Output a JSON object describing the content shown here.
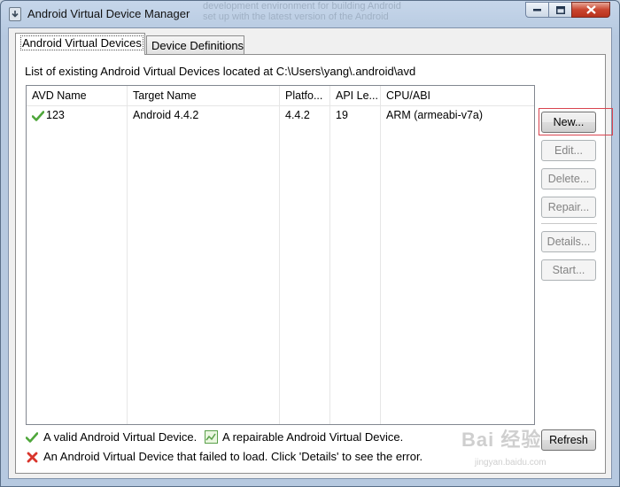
{
  "window": {
    "title": "Android Virtual Device Manager",
    "behind_text": [
      "development environment for building Android",
      "set up with the latest version of the Android"
    ]
  },
  "tabs": [
    {
      "label": "Android Virtual Devices",
      "active": true
    },
    {
      "label": "Device Definitions",
      "active": false
    }
  ],
  "list_label": "List of existing Android Virtual Devices located at C:\\Users\\yang\\.android\\avd",
  "table": {
    "columns": [
      "AVD Name",
      "Target Name",
      "Platfo...",
      "API Le...",
      "CPU/ABI"
    ],
    "rows": [
      {
        "status": "valid",
        "name": "123",
        "target": "Android 4.4.2",
        "platform": "4.4.2",
        "api": "19",
        "cpu": "ARM (armeabi-v7a)"
      }
    ]
  },
  "buttons": {
    "new": "New...",
    "edit": "Edit...",
    "delete": "Delete...",
    "repair": "Repair...",
    "details": "Details...",
    "start": "Start...",
    "refresh": "Refresh"
  },
  "legend": {
    "valid": "A valid Android Virtual Device.",
    "repairable": "A repairable Android Virtual Device.",
    "failed": "An Android Virtual Device that failed to load. Click 'Details' to see the error."
  },
  "watermark": {
    "brand": "Bai 经验",
    "url": "jingyan.baidu.com"
  },
  "colors": {
    "valid": "#4ea63a",
    "failed": "#d9352c",
    "highlight": "#d9444f"
  }
}
